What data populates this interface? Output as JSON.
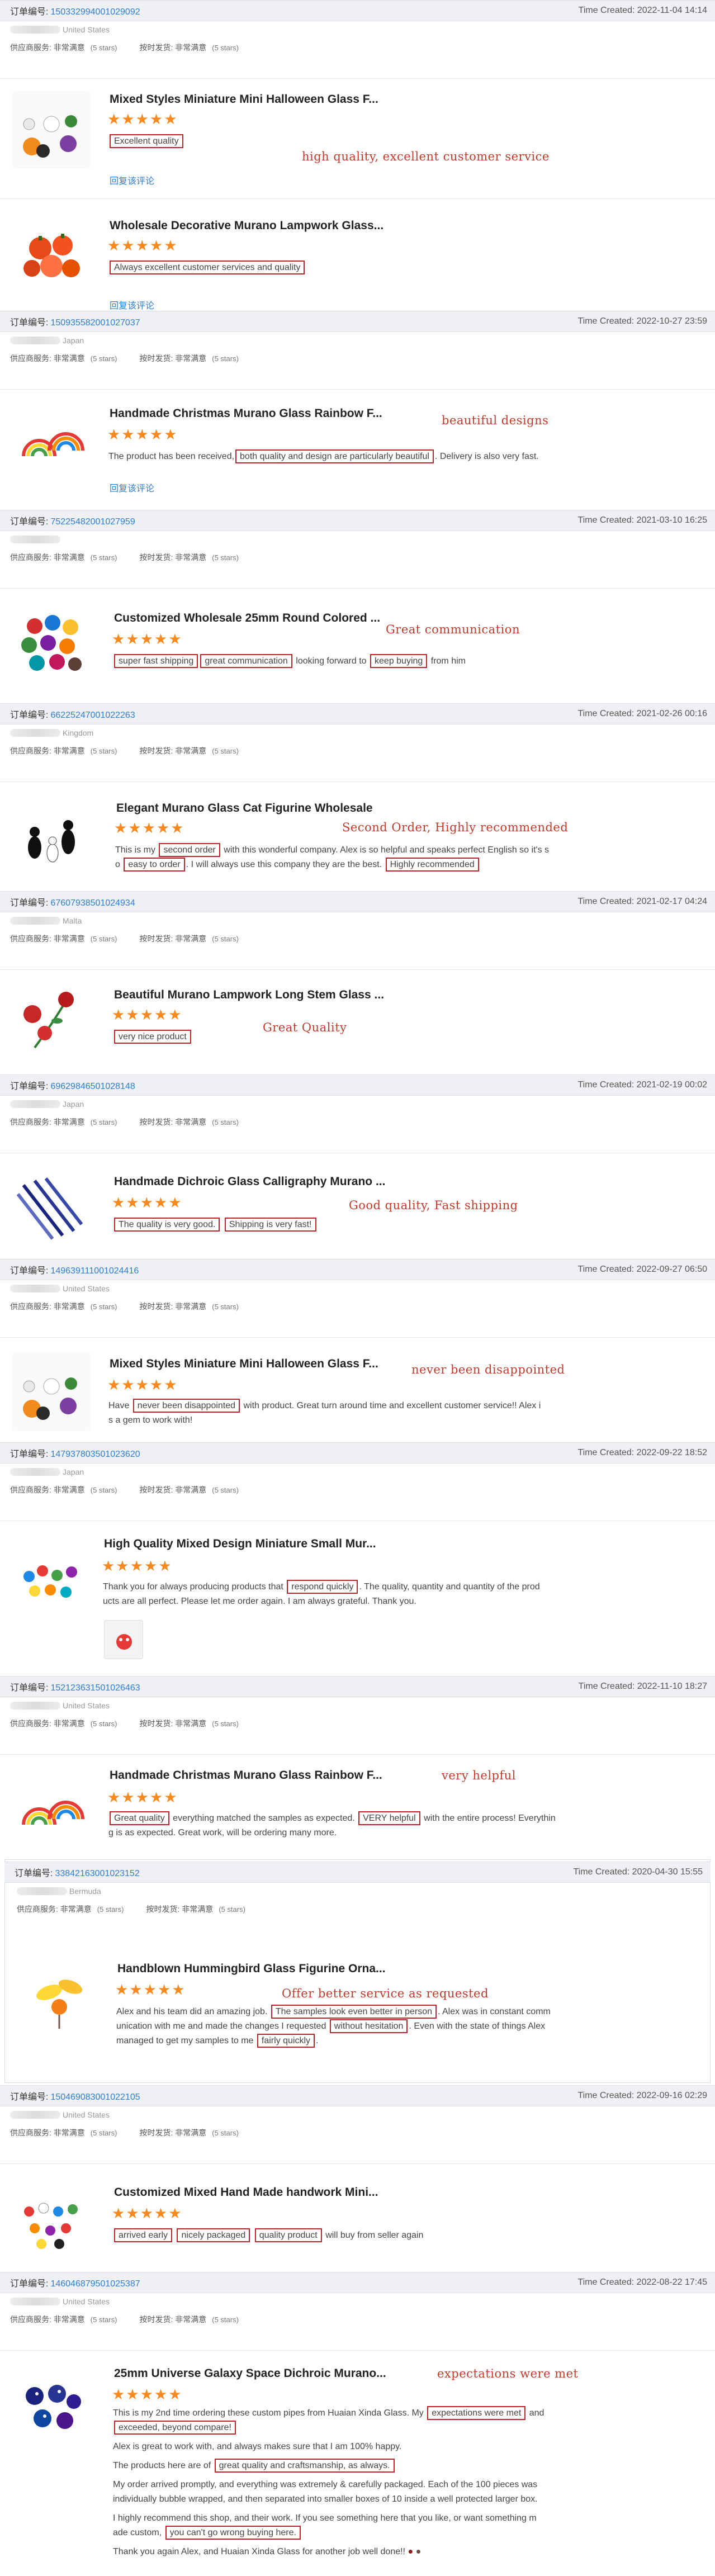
{
  "labels": {
    "order_no": "订单编号:",
    "time_created": "Time Created:",
    "supplier_service": "供应商服务: 非常满意",
    "on_time_delivery": "按时发货: 非常满意",
    "five_stars": "(5 stars)",
    "reply": "回复该评论",
    "stars": "★★★★★"
  },
  "orders": [
    {
      "number": "150332994001029092",
      "time": "Time Created: 2022-11-04 14:14",
      "country": "United States"
    },
    {
      "number": "150935582001027037",
      "time": "Time Created: 2022-10-27 23:59",
      "country": "Japan"
    },
    {
      "number": "75225482001027959",
      "time": "Time Created: 2021-03-10 16:25",
      "country": ""
    },
    {
      "number": "66225247001022263",
      "time": "Time Created: 2021-02-26 00:16",
      "country": "Kingdom"
    },
    {
      "number": "67607938501024934",
      "time": "Time Created: 2021-02-17 04:24",
      "country": "Malta"
    },
    {
      "number": "69629846501028148",
      "time": "Time Created: 2021-02-19 00:02",
      "country": "Japan"
    },
    {
      "number": "149639111001024416",
      "time": "Time Created: 2022-09-27 06:50",
      "country": "United States"
    },
    {
      "number": "147937803501023620",
      "time": "Time Created: 2022-09-22 18:52",
      "country": "Japan"
    },
    {
      "number": "152123631501026463",
      "time": "Time Created: 2022-11-10 18:27",
      "country": "United States"
    },
    {
      "number": "33842163001023152",
      "time": "Time Created: 2020-04-30 15:55",
      "country": "Bermuda"
    },
    {
      "number": "150469083001022105",
      "time": "Time Created: 2022-09-16 02:29",
      "country": "United States"
    },
    {
      "number": "146046879501025387",
      "time": "Time Created: 2022-08-22 17:45",
      "country": "United States"
    }
  ],
  "products": [
    {
      "name": "Mixed Styles Miniature Mini Halloween Glass F...",
      "review_boxed": "Excellent quality",
      "note": "high quality, excellent customer service"
    },
    {
      "name": "Wholesale Decorative Murano Lampwork Glass...",
      "review_boxed": "Always excellent customer services and quality"
    },
    {
      "name": "Handmade Christmas Murano Glass Rainbow F...",
      "review_pre": "The product has been received,",
      "review_boxed": "both quality and design are particularly beautiful",
      "review_post": ". Delivery is also very fast.",
      "note": "beautiful designs"
    },
    {
      "name": "Customized Wholesale 25mm Round Colored ...",
      "b1": "super fast shipping",
      "b2": "great communication",
      "mid": " looking forward to ",
      "b3": "keep buying",
      "post": " from him",
      "note": "Great communication"
    },
    {
      "name": "Elegant Murano Glass Cat Figurine Wholesale",
      "l1a": "This is my ",
      "b1": "second order",
      "l1b": " with this wonderful company. Alex is so helpful and speaks perfect English so it's s",
      "l2a": "o ",
      "b2": "easy to order",
      "l2b": ". I will always use this company they are the best. ",
      "b3": "Highly recommended",
      "note": "Second Order, Highly recommended"
    },
    {
      "name": "Beautiful Murano Lampwork Long Stem Glass ...",
      "review_boxed": "very nice product",
      "note": "Great Quality"
    },
    {
      "name": "Handmade Dichroic Glass Calligraphy Murano ...",
      "b1": "The quality is very good.",
      "b2": "Shipping is very fast!",
      "note": "Good quality, Fast shipping"
    },
    {
      "name": "Mixed Styles Miniature Mini Halloween Glass F...",
      "pre": "Have ",
      "b1": "never been disappointed",
      "post": " with product. Great turn around time and excellent customer service!!  Alex i",
      "l2": "s a gem to work with!",
      "note": "never been disappointed"
    },
    {
      "name": "High Quality Mixed Design Miniature Small Mur...",
      "pre": "Thank you for always producing products that ",
      "b1": "respond quickly",
      "post": ". The quality, quantity and quantity of the prod",
      "l2": "ucts are all perfect.  Please let me order again.  I am always grateful.  Thank you."
    },
    {
      "name": "Handmade Christmas Murano Glass Rainbow F...",
      "b1": "Great quality",
      "mid": " everything matched the samples as expected. ",
      "b2": "VERY helpful",
      "post": " with the entire process! Everythin",
      "l2": "g is as expected. Great work, will be ordering many more.",
      "note": "very helpful"
    },
    {
      "name": "Handblown Hummingbird Glass Figurine Orna...",
      "l1a": "Alex and his team did an amazing job. ",
      "b1": "The samples look even better in person",
      "l1b": ". Alex was in constant comm",
      "l2a": "unication with me and made the changes I requested ",
      "b2": "without hesitation",
      "l2b": ". Even with the state of things Alex",
      "l3a": "managed to get my samples to me ",
      "b3": "fairly quickly",
      "l3b": ".",
      "note": "Offer better service as requested"
    },
    {
      "name": "Customized Mixed Hand Made handwork Mini...",
      "b1": "arrived early",
      "b2": "nicely packaged",
      "b3": "quality product",
      "post": " will buy from seller again"
    },
    {
      "name": "25mm Universe Galaxy Space Dichroic Murano...",
      "l1a": "This is my 2nd time ordering these custom pipes from Huaian Xinda Glass.  My ",
      "b1": "expectations were met",
      "l1b": " and",
      "b2": "exceeded, beyond compare!",
      "p2": "Alex is great to work with, and always makes sure that I am 100% happy.",
      "p3a": "The products here are of ",
      "b3": "great quality and craftsmanship, as always.",
      "p4": "My order arrived promptly, and everything was extremely & carefully packaged.  Each of the 100 pieces was",
      "p4b": "individually bubble wrapped, and then separated into smaller boxes of 10 inside a well protected larger box.",
      "p5a": "I highly recommend this shop, and their work. If you see something here that you like, or want something m",
      "p5b": "ade custom, ",
      "b4": "you can't go wrong buying here.",
      "p6": "Thank you again Alex, and Huaian Xinda Glass for another job well done!!",
      "note": "expectations were met"
    }
  ]
}
